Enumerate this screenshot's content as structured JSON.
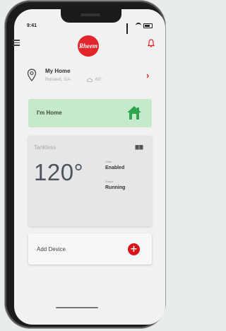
{
  "status_bar": {
    "time": "9:41"
  },
  "header": {
    "logo_text": "Rheem"
  },
  "location": {
    "name": "My Home",
    "city": "Roswell, GA",
    "temperature": "60°"
  },
  "im_home": {
    "label": "I'm Home",
    "accent": "#2ea44f"
  },
  "device": {
    "name": "Tankless",
    "temperature": "120°",
    "state_label": "State",
    "state_value": "Enabled",
    "status_label": "Status",
    "status_value": "Running"
  },
  "add_device": {
    "label": "Add Device",
    "icon": "plus-icon",
    "accent": "#d9141b"
  },
  "colors": {
    "brand": "#e3262b",
    "home_bg": "#c6e9cb",
    "house_icon": "#2ea44f"
  }
}
